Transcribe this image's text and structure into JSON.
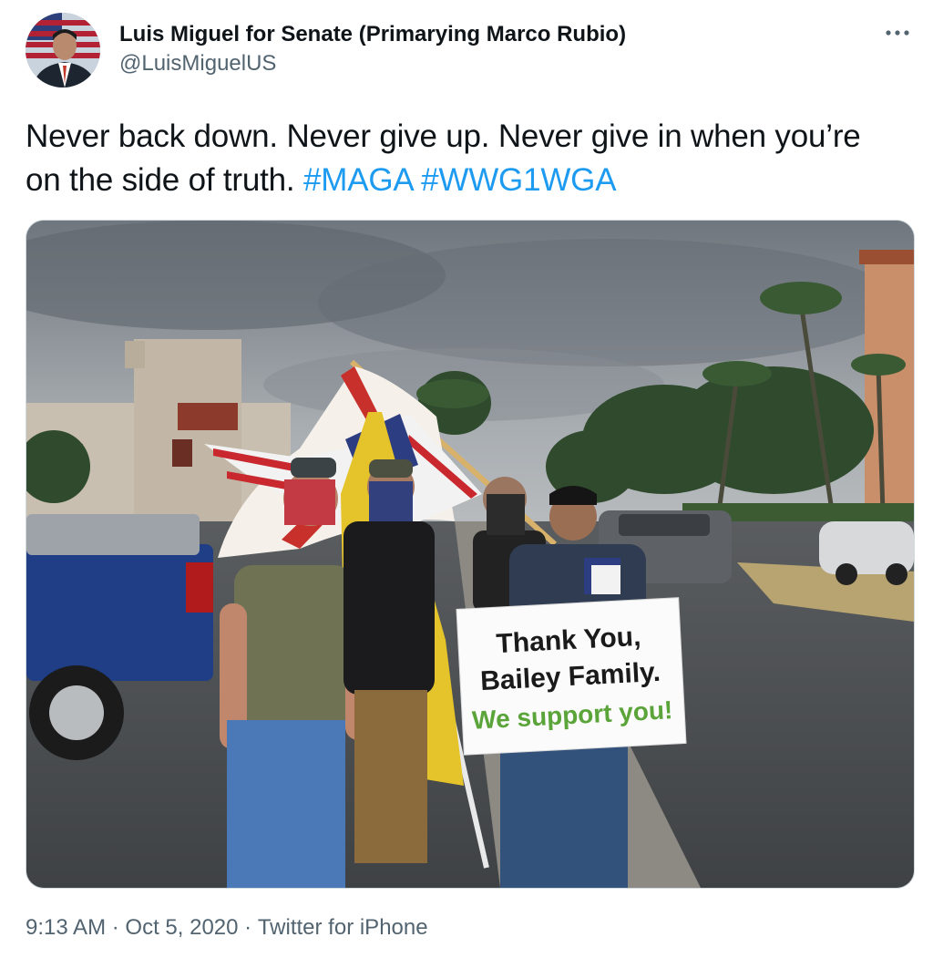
{
  "tweet": {
    "author": {
      "display_name": "Luis Miguel for Senate (Primarying Marco Rubio)",
      "handle": "@LuisMiguelUS"
    },
    "text_segments": [
      {
        "type": "text",
        "value": "Never back down. Never give up. Never give in when you’re on the side of truth. "
      },
      {
        "type": "hashtag",
        "value": "#MAGA"
      },
      {
        "type": "text",
        "value": " "
      },
      {
        "type": "hashtag",
        "value": "#WWG1WGA"
      }
    ],
    "media": {
      "sign_line1": "Thank You,",
      "sign_line2": "Bailey Family.",
      "sign_line3": "We support you!"
    },
    "time": "9:13 AM",
    "date": "Oct 5, 2020",
    "source": "Twitter for iPhone",
    "separator": "·"
  },
  "icons": {
    "more": "more-horizontal-icon"
  },
  "colors": {
    "hashtag": "#1d9bf0",
    "secondary_text": "#536471",
    "primary_text": "#0f1419",
    "border": "#cfd9de"
  }
}
